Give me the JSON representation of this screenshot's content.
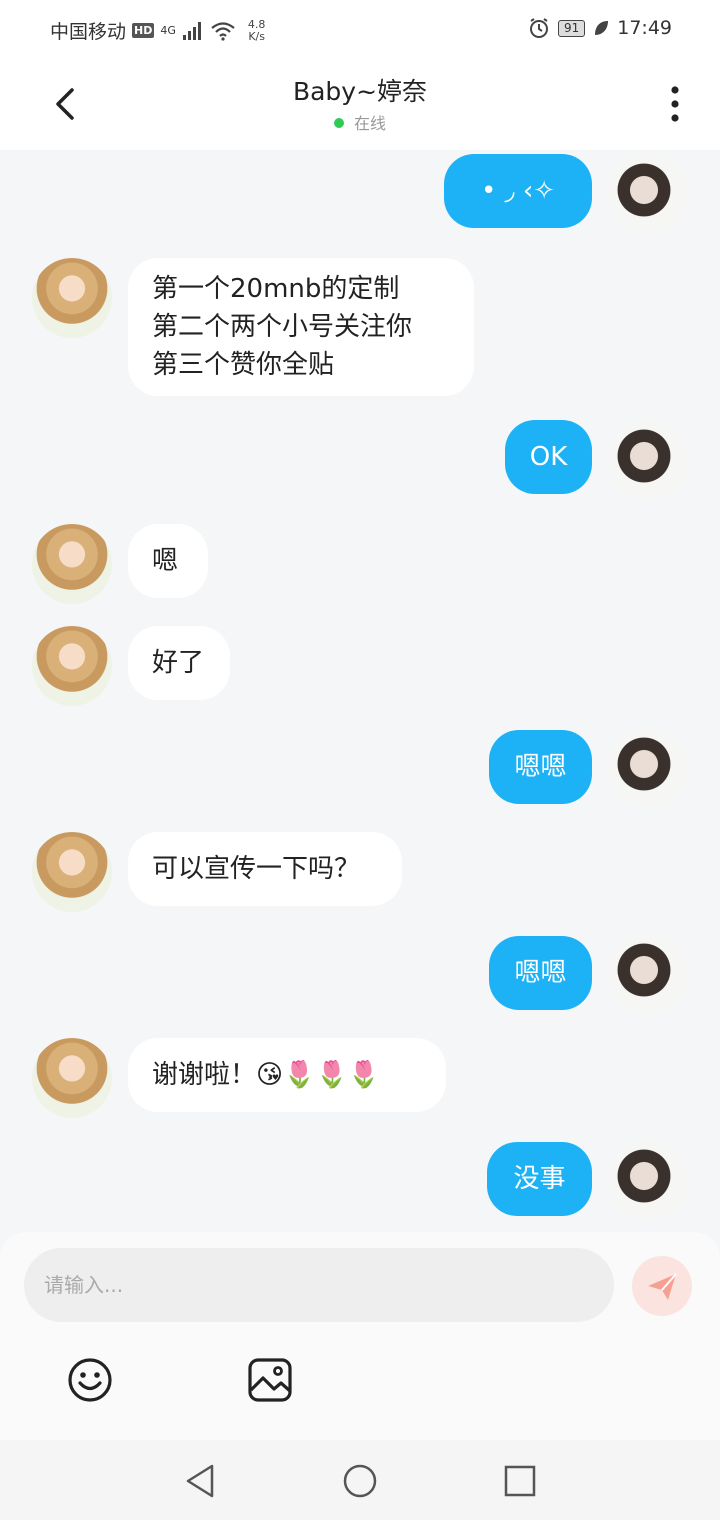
{
  "status_bar": {
    "carrier": "中国移动",
    "hd": "HD",
    "network": "4G",
    "speed_value": "4.8",
    "speed_unit": "K/s",
    "battery": "91",
    "time": "17:49"
  },
  "header": {
    "title": "Baby~婷奈",
    "status": "在线"
  },
  "messages": [
    {
      "side": "out",
      "text": "• ◞ ‹✧"
    },
    {
      "side": "in",
      "text": "第一个20mnb的定制\n第二个两个小号关注你\n第三个赞你全贴"
    },
    {
      "side": "out",
      "text": "OK"
    },
    {
      "side": "in",
      "text": "嗯"
    },
    {
      "side": "in",
      "text": "好了"
    },
    {
      "side": "out",
      "text": "嗯嗯"
    },
    {
      "side": "in",
      "text": "可以宣传一下吗？"
    },
    {
      "side": "out",
      "text": "嗯嗯"
    },
    {
      "side": "in",
      "text": "谢谢啦！😘🌷🌷🌷"
    },
    {
      "side": "out",
      "text": "没事"
    }
  ],
  "input": {
    "placeholder": "请输入...",
    "value": ""
  },
  "colors": {
    "accent": "#1db2f5",
    "send_button": "#f6a093",
    "online": "#2ecc55"
  }
}
